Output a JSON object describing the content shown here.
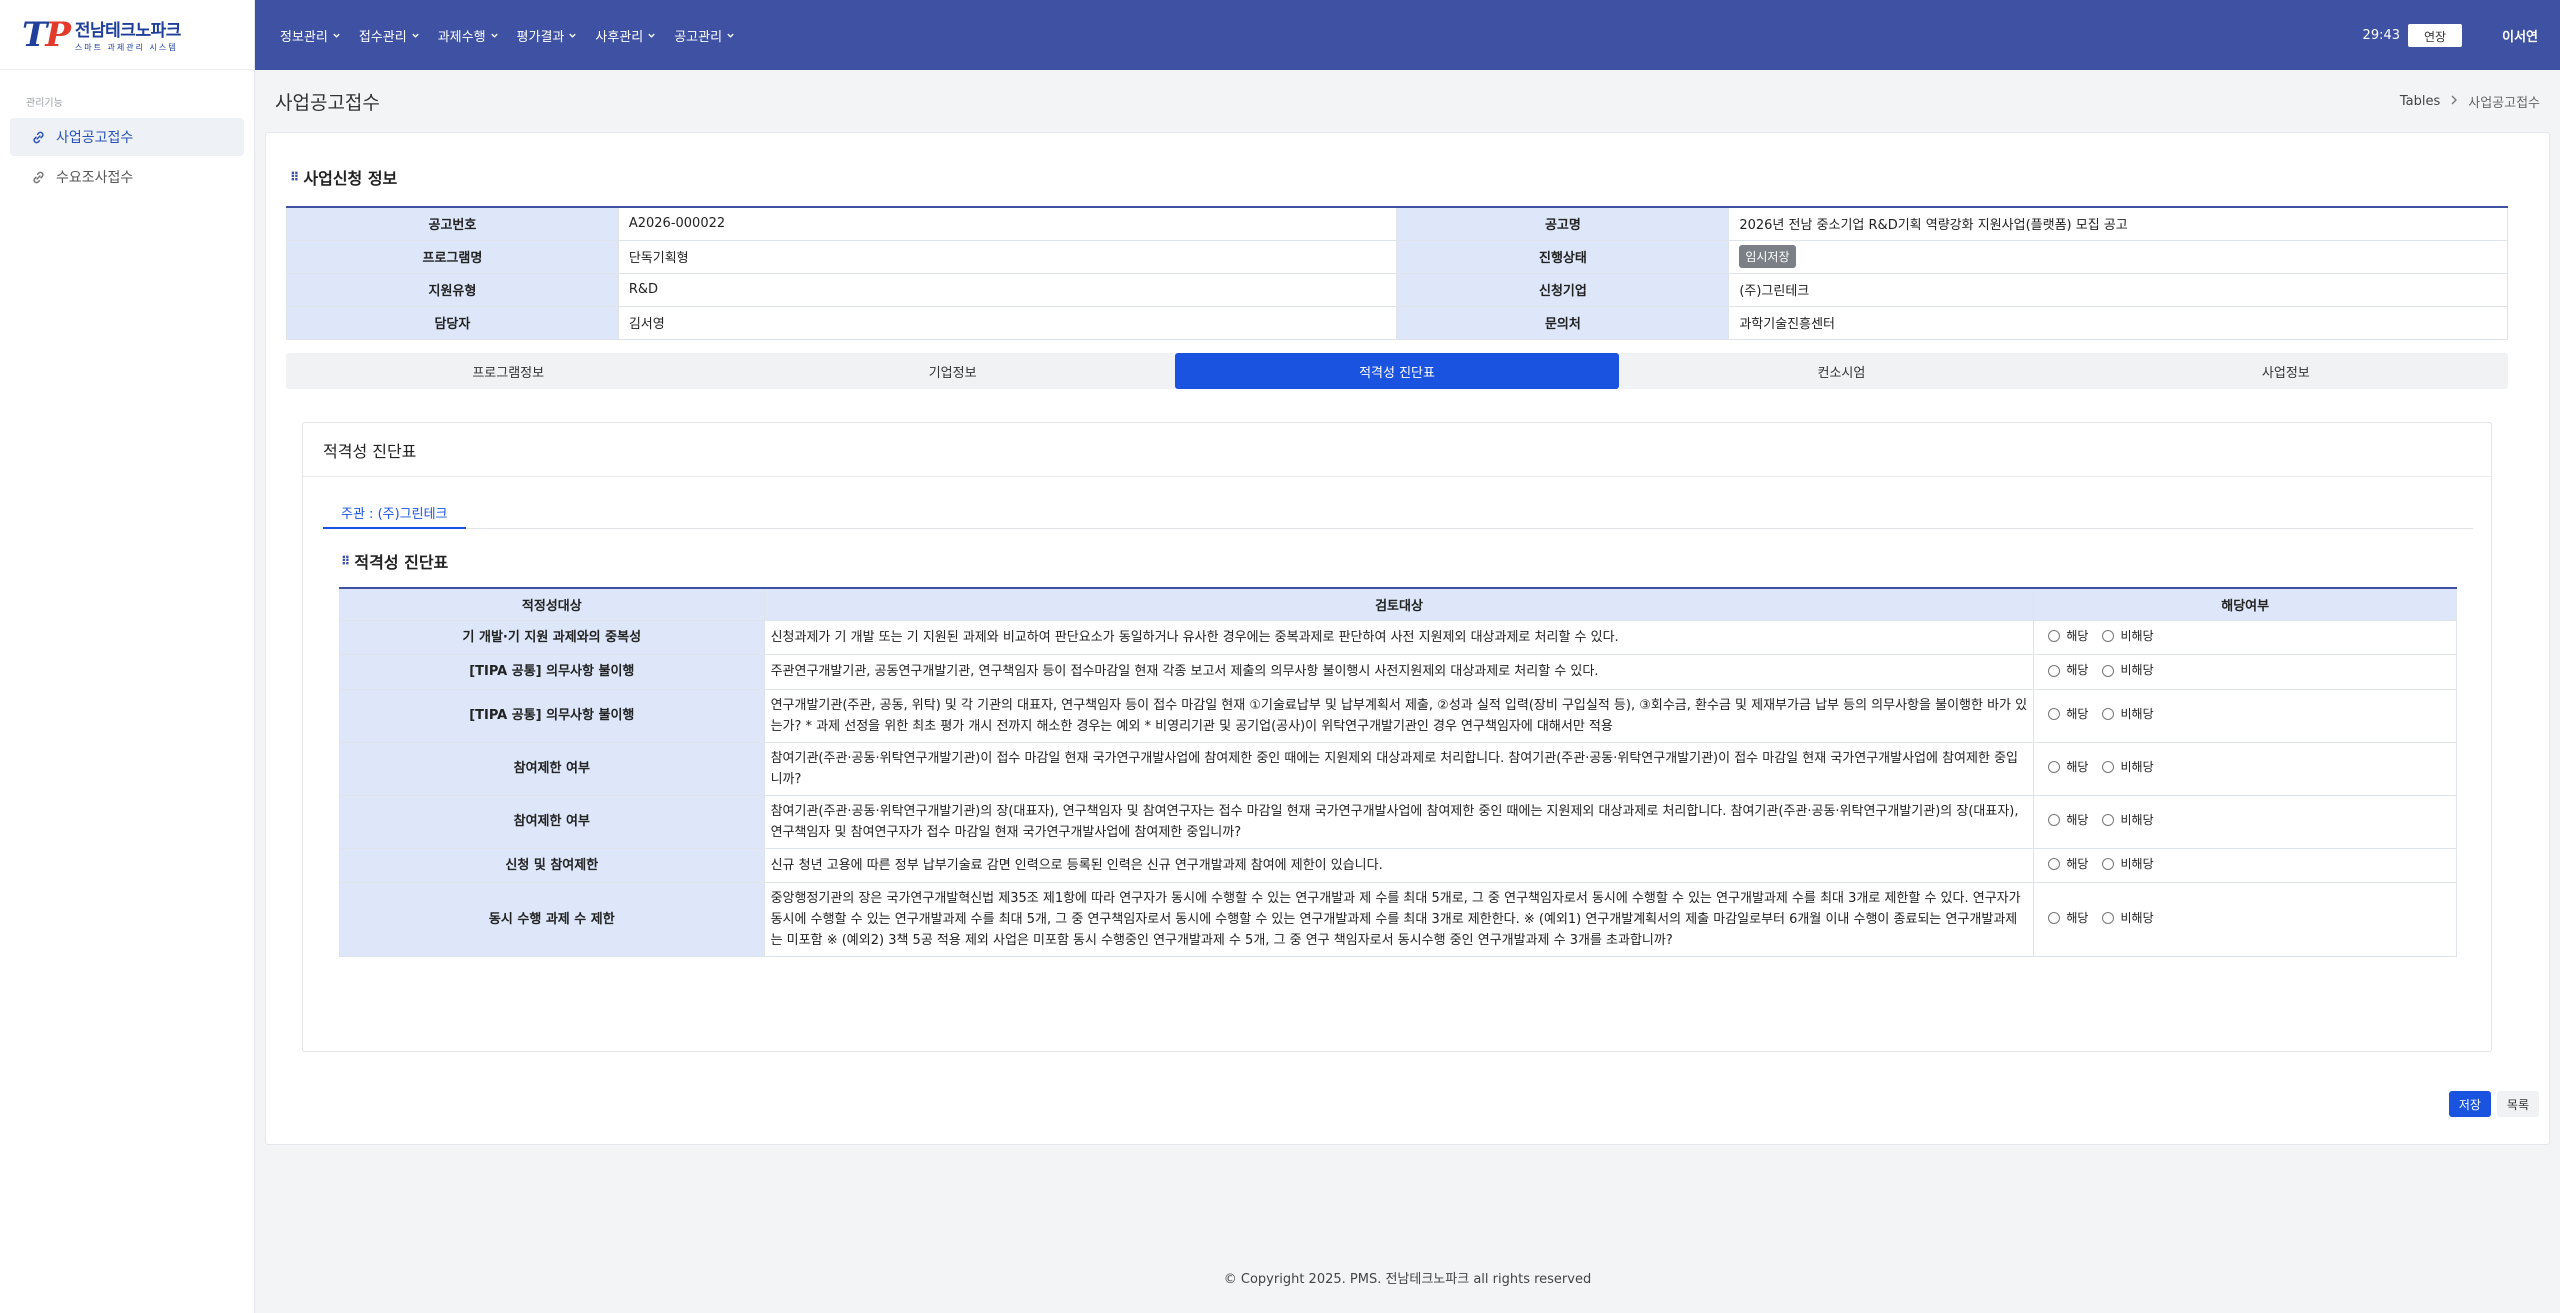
{
  "logo": {
    "mark_t": "T",
    "mark_p": "P",
    "title": "전남테크노파크",
    "subtitle": "스마트 과제관리 시스템"
  },
  "sidebar": {
    "section_label": "관리기능",
    "items": [
      {
        "label": "사업공고접수",
        "active": true
      },
      {
        "label": "수요조사접수",
        "active": false
      }
    ]
  },
  "topbar": {
    "menu": [
      "정보관리",
      "접수관리",
      "과제수행",
      "평가결과",
      "사후관리",
      "공고관리"
    ],
    "timer": "29:43",
    "extend_label": "연장",
    "user": "이서연"
  },
  "page": {
    "title": "사업공고접수",
    "breadcrumb": [
      "Tables",
      "사업공고접수"
    ]
  },
  "info": {
    "section_title": "사업신청 정보",
    "rows": [
      {
        "l1": "공고번호",
        "v1": "A2026-000022",
        "l2": "공고명",
        "v2": "2026년 전남 중소기업 R&D기획 역량강화 지원사업(플랫폼) 모집 공고"
      },
      {
        "l1": "프로그램명",
        "v1": "단독기획형",
        "l2": "진행상태",
        "v2": "임시저장"
      },
      {
        "l1": "지원유형",
        "v1": "R&D",
        "l2": "신청기업",
        "v2": "(주)그린테크"
      },
      {
        "l1": "담당자",
        "v1": "김서영",
        "l2": "문의처",
        "v2": "과학기술진흥센터"
      }
    ]
  },
  "tabs": [
    {
      "label": "프로그램정보",
      "active": false
    },
    {
      "label": "기업정보",
      "active": false
    },
    {
      "label": "적격성 진단표",
      "active": true
    },
    {
      "label": "컨소시엄",
      "active": false
    },
    {
      "label": "사업정보",
      "active": false
    }
  ],
  "diagnosis": {
    "card_title": "적격성 진단표",
    "subtab": "주관 : (주)그린테크",
    "section_title": "적격성 진단표",
    "headers": [
      "적정성대상",
      "검토대상",
      "해당여부"
    ],
    "option_yes": "해당",
    "option_no": "비해당",
    "rows": [
      {
        "target": "기 개발·기 지원 과제와의 중복성",
        "desc": "신청과제가 기 개발 또는 기 지원된 과제와 비교하여 판단요소가 동일하거나 유사한 경우에는 중복과제로 판단하여 사전 지원제외 대상과제로 처리할 수 있다."
      },
      {
        "target": "[TIPA 공통] 의무사항 불이행",
        "desc": "주관연구개발기관, 공동연구개발기관, 연구책임자 등이 접수마감일 현재 각종 보고서 제출의 의무사항 불이행시 사전지원제외 대상과제로 처리할 수 있다."
      },
      {
        "target": "[TIPA 공통] 의무사항 불이행",
        "desc": "연구개발기관(주관, 공동, 위탁) 및 각 기관의 대표자, 연구책임자 등이 접수 마감일 현재 ①기술료납부 및 납부계획서 제출, ②성과 실적 입력(장비 구입실적 등), ③회수금, 환수금 및 제재부가금 납부 등의 의무사항을 불이행한 바가 있는가? * 과제 선정을 위한 최초 평가 개시 전까지 해소한 경우는 예외 * 비영리기관 및 공기업(공사)이 위탁연구개발기관인 경우 연구책임자에 대해서만 적용"
      },
      {
        "target": "참여제한 여부",
        "desc": "참여기관(주관·공동·위탁연구개발기관)이 접수 마감일 현재 국가연구개발사업에 참여제한 중인 때에는 지원제외 대상과제로 처리합니다. 참여기관(주관·공동·위탁연구개발기관)이 접수 마감일 현재 국가연구개발사업에 참여제한 중입니까?"
      },
      {
        "target": "참여제한 여부",
        "desc": "참여기관(주관·공동·위탁연구개발기관)의 장(대표자), 연구책임자 및 참여연구자는 접수 마감일 현재 국가연구개발사업에 참여제한 중인 때에는 지원제외 대상과제로 처리합니다. 참여기관(주관·공동·위탁연구개발기관)의 장(대표자), 연구책임자 및 참여연구자가 접수 마감일 현재 국가연구개발사업에 참여제한 중입니까?"
      },
      {
        "target": "신청 및 참여제한",
        "desc": "신규 청년 고용에 따른 정부 납부기술료 감면 인력으로 등록된 인력은 신규 연구개발과제 참여에 제한이 있습니다."
      },
      {
        "target": "동시 수행 과제 수 제한",
        "desc": "중앙행정기관의 장은 국가연구개발혁신법 제35조 제1항에 따라 연구자가 동시에 수행할 수 있는 연구개발과 제 수를 최대 5개로, 그 중 연구책임자로서 동시에 수행할 수 있는 연구개발과제 수를 최대 3개로 제한할 수 있다. 연구자가 동시에 수행할 수 있는 연구개발과제 수를 최대 5개, 그 중 연구책임자로서 동시에 수행할 수 있는 연구개발과제 수를 최대 3개로 제한한다. ※ (예외1) 연구개발계획서의 제출 마감일로부터 6개월 이내 수행이 종료되는 연구개발과제는 미포함 ※ (예외2) 3책 5공 적용 제외 사업은 미포함 동시 수행중인 연구개발과제 수 5개, 그 중 연구 책임자로서 동시수행 중인 연구개발과제 수 3개를 초과합니까?"
      }
    ]
  },
  "actions": {
    "save": "저장",
    "list": "목록"
  },
  "footer": "© Copyright 2025. PMS. 전남테크노파크 all rights reserved"
}
